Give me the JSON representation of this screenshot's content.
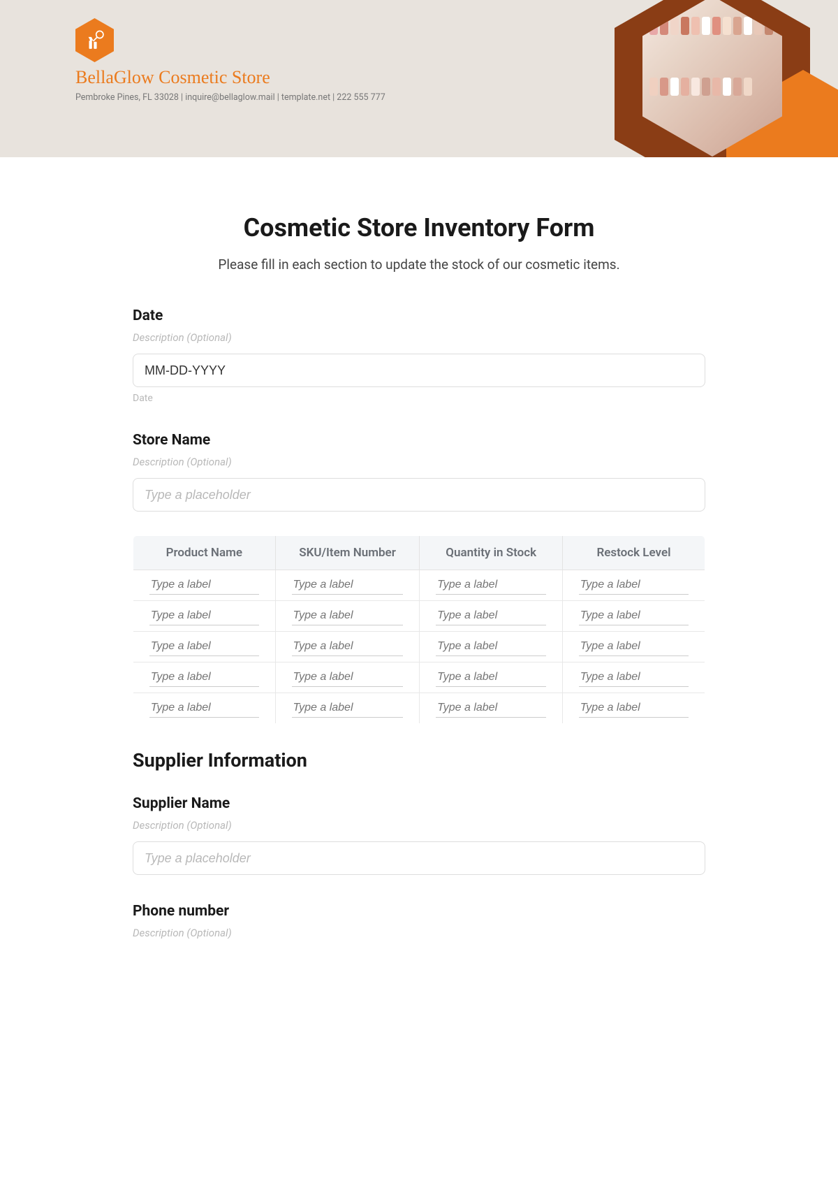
{
  "header": {
    "store_name": "BellaGlow Cosmetic Store",
    "contact_line": "Pembroke Pines, FL 33028 | inquire@bellaglow.mail | template.net | 222 555 777"
  },
  "form": {
    "title": "Cosmetic Store Inventory Form",
    "subtitle": "Please fill in each section to update the stock of our cosmetic items."
  },
  "date_field": {
    "label": "Date",
    "desc": "Description (Optional)",
    "value": "MM-DD-YYYY",
    "sublabel": "Date"
  },
  "store_name_field": {
    "label": "Store Name",
    "desc": "Description (Optional)",
    "placeholder": "Type a placeholder"
  },
  "table": {
    "headers": [
      "Product Name",
      "SKU/Item Number",
      "Quantity in Stock",
      "Restock Level"
    ],
    "cell_placeholder": "Type a label",
    "row_count": 5
  },
  "supplier_section": {
    "heading": "Supplier Information"
  },
  "supplier_name_field": {
    "label": "Supplier Name",
    "desc": "Description (Optional)",
    "placeholder": "Type a placeholder"
  },
  "phone_field": {
    "label": "Phone number",
    "desc": "Description (Optional)"
  }
}
